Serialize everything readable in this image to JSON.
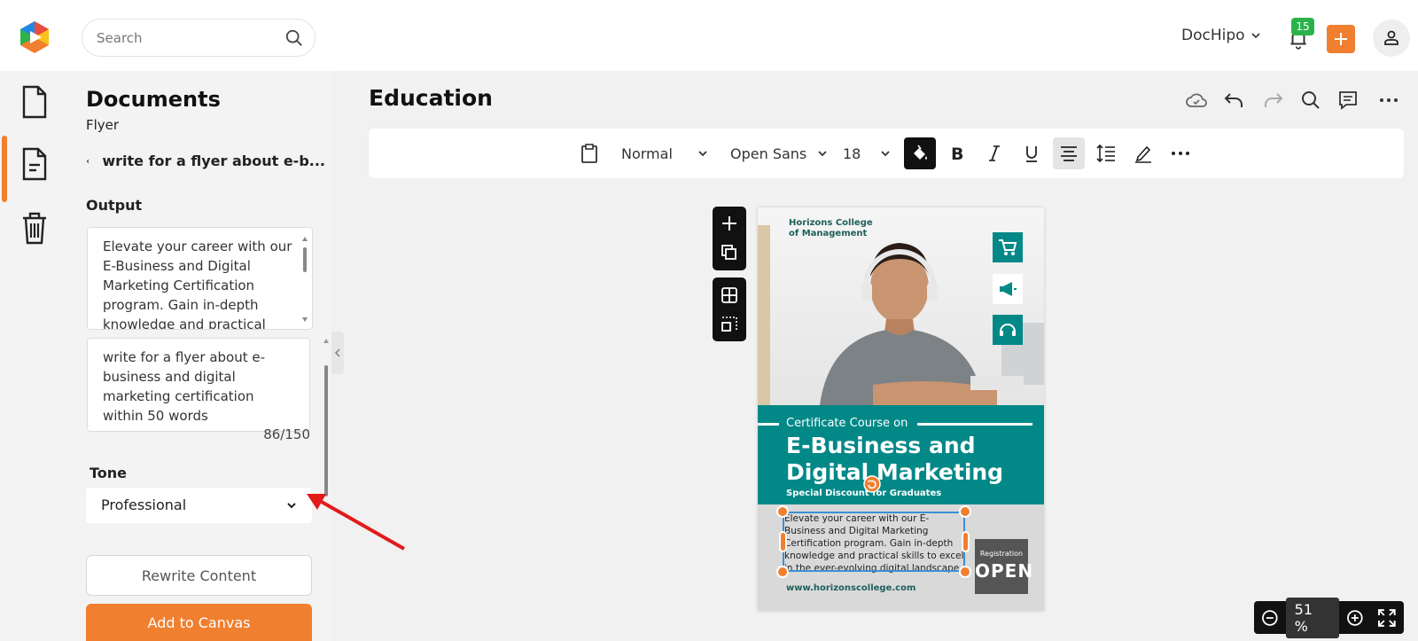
{
  "header": {
    "search_placeholder": "Search",
    "brand": "DocHipo",
    "notification_count": "15"
  },
  "panel": {
    "title": "Documents",
    "subtitle": "Flyer",
    "prompt_short": "write for a flyer about e-b...",
    "output_label": "Output",
    "output_text": "Elevate your career with our E-Business and Digital Marketing Certification program. Gain in-depth knowledge and practical skills",
    "prompt_text": "write for a flyer about e-business and digital marketing certification within 50 words",
    "char_count": "86/150",
    "tone_label": "Tone",
    "tone_value": "Professional",
    "rewrite_label": "Rewrite Content",
    "add_label": "Add to Canvas"
  },
  "main": {
    "title": "Education"
  },
  "toolbar": {
    "style": "Normal",
    "font": "Open Sans",
    "size": "18"
  },
  "flyer": {
    "college_line1": "Horizons College",
    "college_line2": "of Management",
    "cert_line": "Certificate Course on",
    "title_line1": "E-Business and",
    "title_line2": "Digital Marketing",
    "special": "Special Discount for Graduates",
    "body": "Elevate your career with our E-Business and Digital Marketing Certification program. Gain in-depth knowledge and practical skills to excel in the ever-evolving digital landscape.",
    "url": "www.horizonscollege.com",
    "reg_label": "Registration",
    "reg_status": "OPEN"
  },
  "zoom": {
    "value": "51",
    "unit": "%"
  },
  "colors": {
    "accent": "#f07f2f",
    "teal": "#028987",
    "badge": "#2bb34b"
  }
}
